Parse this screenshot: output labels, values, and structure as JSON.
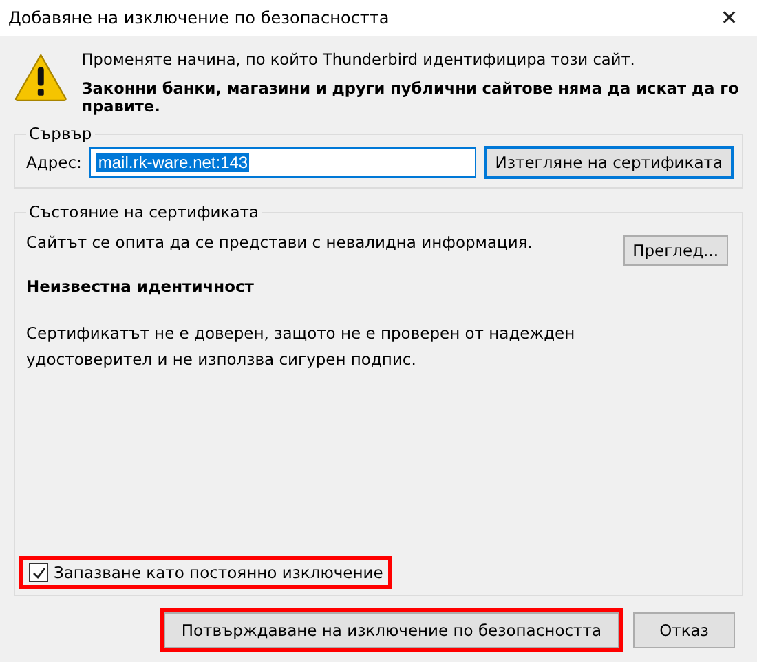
{
  "window": {
    "title": "Добавяне на изключение по безопасността",
    "close": "✕"
  },
  "warning": {
    "line_1": "Променяте начина, по който Thunderbird идентифицира този сайт.",
    "line_2": "Законни банки, магазини и други публични сайтове няма да искат да го правите."
  },
  "server": {
    "legend": "Сървър",
    "address_label": "Адрес:",
    "address_value": "mail.rk-ware.net:143",
    "value_selected": true,
    "fetch_button": "Изтегляне на сертификата"
  },
  "certificate_status": {
    "legend": "Състояние на сертификата",
    "summary": "Сайтът се опита да се представи с невалидна информация.",
    "view_button": "Преглед...",
    "heading": "Неизвестна идентичност",
    "details": "Сертификатът не е доверен, защото не е проверен от надежден удостоверител и не използва сигурен подпис."
  },
  "permanent_checkbox": {
    "label": "Запазване като постоянно изключение",
    "checked": true,
    "highlighted": true
  },
  "buttons": [
    {
      "label": "Потвърждаване на изключение по безопасността",
      "highlighted": true
    },
    {
      "label": "Отказ",
      "highlighted": false
    }
  ]
}
